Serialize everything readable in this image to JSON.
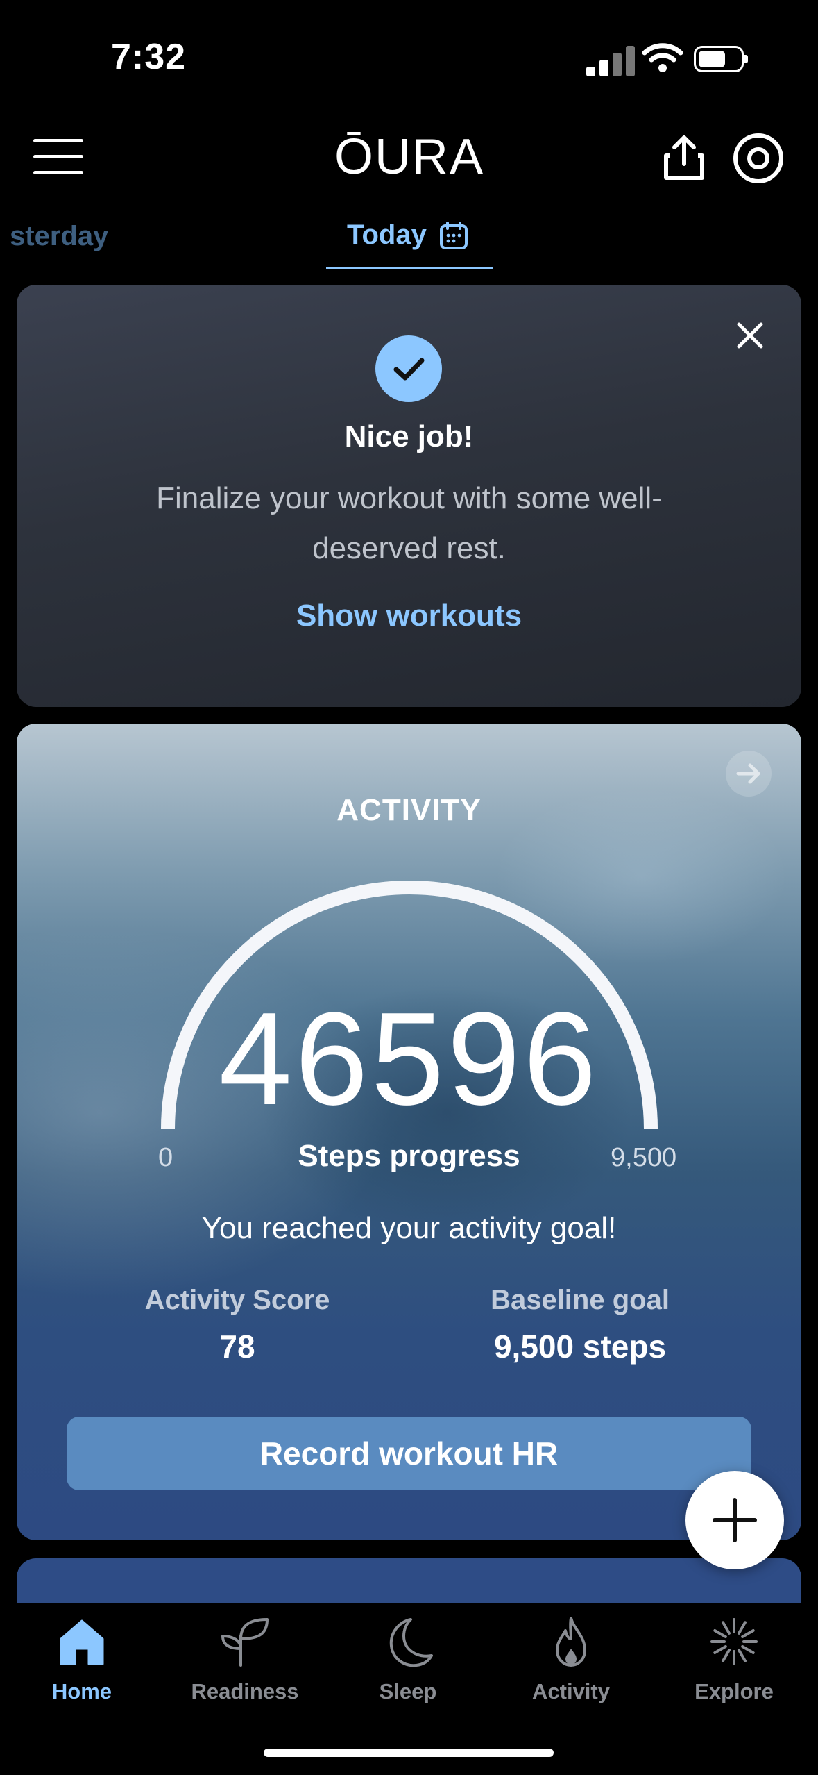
{
  "status_bar": {
    "time": "7:32"
  },
  "header": {
    "logo": "ŌURA",
    "menu_icon": "hamburger-icon",
    "share_icon": "share-icon",
    "profile_icon": "profile-ring-icon"
  },
  "date_tabs": {
    "previous": "sterday",
    "current": "Today"
  },
  "banner": {
    "title": "Nice job!",
    "message": "Finalize your workout with some well-deserved rest.",
    "link": "Show workouts"
  },
  "activity": {
    "title": "ACTIVITY",
    "steps": "46596",
    "gauge_min": "0",
    "gauge_max": "9,500",
    "steps_label": "Steps progress",
    "goal_message": "You reached your activity goal!",
    "score_label": "Activity Score",
    "score_value": "78",
    "baseline_label": "Baseline goal",
    "baseline_value": "9,500 steps",
    "record_button": "Record workout HR",
    "progress_fraction": 1.0
  },
  "bottom_nav": [
    {
      "label": "Home",
      "icon": "home-icon",
      "active": true
    },
    {
      "label": "Readiness",
      "icon": "sprout-icon",
      "active": false
    },
    {
      "label": "Sleep",
      "icon": "moon-icon",
      "active": false
    },
    {
      "label": "Activity",
      "icon": "flame-icon",
      "active": false
    },
    {
      "label": "Explore",
      "icon": "sparkle-icon",
      "active": false
    }
  ],
  "colors": {
    "accent": "#8cc7ff",
    "button": "#5a8bc0",
    "inactive": "#8a8d93"
  }
}
